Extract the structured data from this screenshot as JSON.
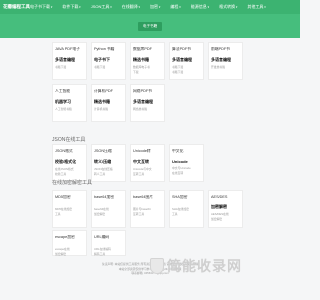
{
  "header": {
    "logo": "花瓣编程工具箱",
    "nav": [
      "电子书下载",
      "软件下载",
      "JSON工具",
      "在线翻译",
      "加密",
      "编程",
      "能源信息",
      "格式转换",
      "其他工具"
    ]
  },
  "subbar": {
    "badge": "电子书籍"
  },
  "sections": [
    {
      "title": "电子书籍",
      "cards": [
        {
          "title": "JAVA PDF电子",
          "sub": "多语言编程",
          "line1": "书籍下载",
          "line2": ""
        },
        {
          "title": "Python 书籍",
          "sub": "电子书下",
          "line1": "书籍下载",
          "line2": ""
        },
        {
          "title": "数据库PDF",
          "sub": "精选书籍",
          "line1": "数据库电子书",
          "line2": "下载"
        },
        {
          "title": "算法PDF书",
          "sub": "多语言编程",
          "line1": "书籍下载",
          "line2": "书籍下载"
        },
        {
          "title": "前端PDF书",
          "sub": "多语言编程",
          "line1": "开发类书籍",
          "line2": ""
        },
        {
          "title": "人工智能",
          "sub": "机器学习",
          "line1": "人工智能书籍",
          "line2": ""
        },
        {
          "title": "计算机PDF",
          "sub": "精选书籍",
          "line1": "计算机书籍",
          "line2": ""
        },
        {
          "title": "网络PDF书",
          "sub": "多语言编程",
          "line1": "网络类书籍",
          "line2": ""
        }
      ]
    },
    {
      "title": "JSON在线工具",
      "cards": [
        {
          "title": "JSON格式",
          "sub": "校验/格式化",
          "line1": "在线JSON格式",
          "line2": "校验工具"
        },
        {
          "title": "JSON压缩",
          "sub": "转义/压缩",
          "line1": "JSON在线压缩",
          "line2": "转义工具"
        },
        {
          "title": "Unicode转",
          "sub": "中文互转",
          "line1": "Unicode与中文",
          "line2": "互转工具"
        },
        {
          "title": "中文化",
          "sub": "Unicode",
          "line1": "中文与Unicode",
          "line2": "在线互转"
        }
      ]
    },
    {
      "title": "在线加密解密工具",
      "cards": [
        {
          "title": "MD5加密",
          "sub": "",
          "line1": "MD5在线加密",
          "line2": "工具"
        },
        {
          "title": "base64加密",
          "sub": "",
          "line1": "base64在线",
          "line2": "加密解密"
        },
        {
          "title": "base64图片",
          "sub": "",
          "line1": "图片与base64",
          "line2": "互转工具"
        },
        {
          "title": "SHA加密",
          "sub": "",
          "line1": "SHA在线加密",
          "line2": "工具"
        },
        {
          "title": "AES/DES",
          "sub": "加密解密",
          "line1": "AES/DES在线",
          "line2": "加密解密"
        },
        {
          "title": "escape加密",
          "sub": "",
          "line1": "escape在线",
          "line2": "加密解密"
        },
        {
          "title": "URL编码",
          "sub": "",
          "line1": "URL在线编码",
          "line2": "解码工具"
        }
      ]
    }
  ],
  "footer": {
    "line1": "免责声明: 本站仅提供工具服务 所有资源均来自网络 请勿商用 侵权请联系删除",
    "line2": "本站全部资源仅供学习参考 请在下载24小时内删除",
    "line3": "联系邮箱: 345634***@qq.com"
  },
  "watermark": {
    "text": "简能收录网"
  }
}
